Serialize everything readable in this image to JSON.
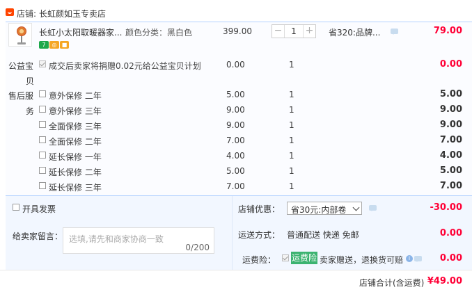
{
  "shop": {
    "label": "店铺:",
    "name": "长虹颜如玉专卖店"
  },
  "product": {
    "title": "长虹小太阳取暖器家...",
    "sku": "颜色分类：黑白色",
    "price": "399.00",
    "quantity": "1",
    "discount": "省320:品牌...",
    "subtotal": "79.00",
    "badges": [
      {
        "text": "7",
        "color": "#1ea84a"
      },
      {
        "text": "◎",
        "color": "#f5a623"
      },
      {
        "text": "■",
        "color": "#f5a623"
      }
    ]
  },
  "charity": {
    "label_1": "公益宝",
    "label_2": "贝",
    "text": "成交后卖家将捐赠0.02元给公益宝贝计划",
    "price": "0.00",
    "qty": "1",
    "subtotal": "0.00"
  },
  "service": {
    "label_1": "售后服",
    "label_2": "务",
    "options": [
      {
        "name": "意外保修 二年",
        "price": "5.00",
        "qty": "1",
        "subtotal": "5.00"
      },
      {
        "name": "意外保修 三年",
        "price": "9.00",
        "qty": "1",
        "subtotal": "9.00"
      },
      {
        "name": "全面保修 三年",
        "price": "9.00",
        "qty": "1",
        "subtotal": "9.00"
      },
      {
        "name": "全面保修 二年",
        "price": "7.00",
        "qty": "1",
        "subtotal": "7.00"
      },
      {
        "name": "延长保修 一年",
        "price": "4.00",
        "qty": "1",
        "subtotal": "4.00"
      },
      {
        "name": "延长保修 二年",
        "price": "5.00",
        "qty": "1",
        "subtotal": "5.00"
      },
      {
        "name": "延长保修 三年",
        "price": "7.00",
        "qty": "1",
        "subtotal": "7.00"
      }
    ]
  },
  "invoice": {
    "label": "开具发票"
  },
  "message": {
    "label": "给卖家留言：",
    "placeholder": "选填,请先和商家协商一致",
    "counter": "0/200"
  },
  "shop_discount": {
    "label": "店铺优惠：",
    "selected": "省30元:内部卷",
    "amount": "-30.00"
  },
  "shipping": {
    "label": "运送方式：",
    "method": "普通配送 快递 免邮",
    "amount": "0.00"
  },
  "freight_insurance": {
    "label": "运费险：",
    "tag": "运费险",
    "text": "卖家赠送，退换货可赔",
    "amount": "0.00"
  },
  "total": {
    "label": "店铺合计(含运费)",
    "amount": "¥49.00"
  }
}
